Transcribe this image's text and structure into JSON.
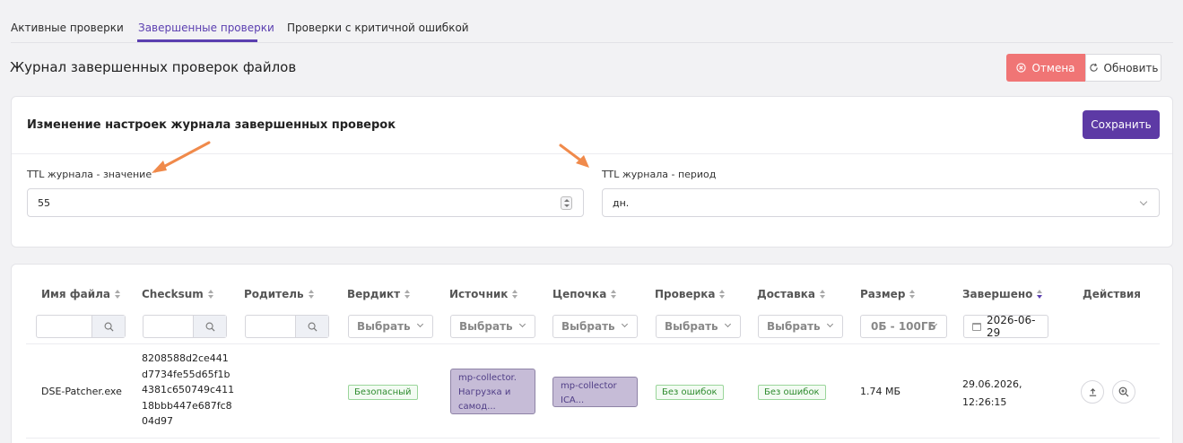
{
  "tabs": [
    {
      "label": "Активные проверки",
      "active": false
    },
    {
      "label": "Завершенные проверки",
      "active": true
    },
    {
      "label": "Проверки с критичной ошибкой",
      "active": false
    }
  ],
  "page": {
    "title": "Журнал завершенных проверок файлов",
    "cancel_label": "Отмена",
    "refresh_label": "Обновить"
  },
  "settings": {
    "title": "Изменение настроек журнала завершенных проверок",
    "save_label": "Сохранить",
    "ttl_value_label": "TTL журнала - значение",
    "ttl_value": "55",
    "ttl_period_label": "TTL журнала - период",
    "ttl_period": "дн."
  },
  "table": {
    "columns": {
      "filename": "Имя файла",
      "checksum": "Checksum",
      "parent": "Родитель",
      "verdict": "Вердикт",
      "source": "Источник",
      "chain": "Цепочка",
      "check": "Проверка",
      "delivery": "Доставка",
      "size": "Размер",
      "finished": "Завершено",
      "actions": "Действия"
    },
    "filters": {
      "select_placeholder": "Выбрать",
      "size_range": "0Б - 100ГБ",
      "date": "2026-06-29"
    },
    "rows": [
      {
        "filename": "DSE-Patcher.exe",
        "checksum_lines": [
          "8208588d2ce441",
          "d7734fe55d65f1b",
          "4381c650749c411",
          "18bbb447e687fc8",
          "04d97"
        ],
        "parent": "",
        "verdict": "Безопасный",
        "source_lines": [
          "mp-collector.",
          "Нагрузка и",
          "самод..."
        ],
        "chain_lines": [
          "mp-collector",
          "ICA..."
        ],
        "check": "Без ошибок",
        "delivery": "Без ошибок",
        "size": "1.74 МБ",
        "finished_date": "29.06.2026,",
        "finished_time": "12:26:15"
      }
    ]
  },
  "colors": {
    "accent": "#5b3fb0",
    "cancel": "#f07575",
    "save": "#5d3aa5",
    "success": "#2e8b2e",
    "chip_bg": "#c6bcd7",
    "annotation_arrow": "#f08a4b"
  },
  "icons": {
    "cancel": "x-circle-icon",
    "refresh": "refresh-icon",
    "search": "search-icon",
    "calendar": "calendar-icon",
    "upload": "upload-icon",
    "zoom": "zoom-in-icon"
  }
}
